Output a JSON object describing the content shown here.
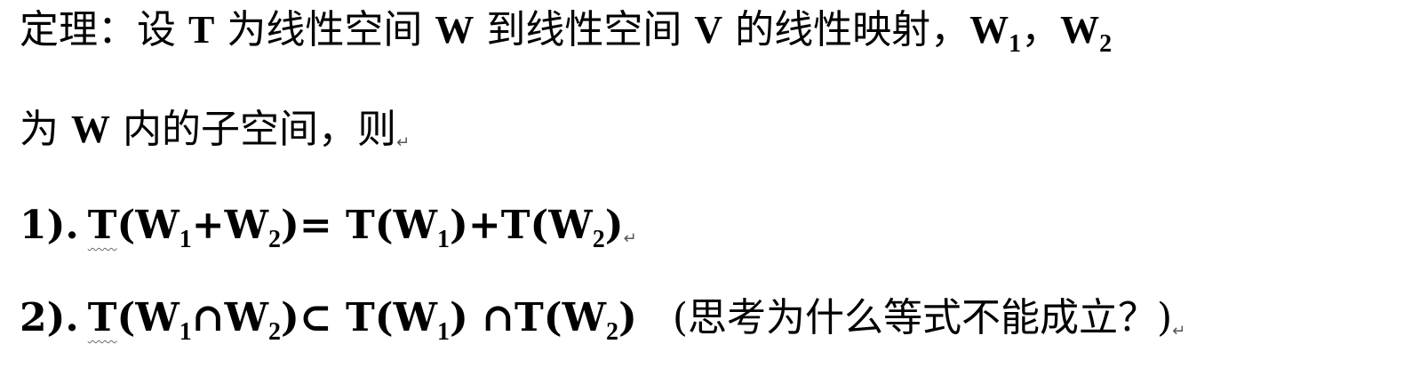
{
  "line1": {
    "label": "定理：设",
    "t": "T",
    "p1": "为线性空间",
    "w": "W",
    "p2": "到线性空间",
    "v": "V",
    "p3": "的线性映射，",
    "w1": "W",
    "sub1": "1",
    "comma": "，",
    "w2": "W",
    "sub2": "2"
  },
  "line2": {
    "p1": "为",
    "w": "W",
    "p2": "内的子空间，则"
  },
  "item1": {
    "num": "1).",
    "lhs_t": "T",
    "lhs_rest": "(W",
    "s1": "1",
    "mid": "+W",
    "s2": "2",
    "eq": ")= T(W",
    "s3": "1",
    "mid2": ")+T(W",
    "s4": "2",
    "end": ")"
  },
  "item2": {
    "num": "2).",
    "lhs_t": "T",
    "lhs_rest": "(W",
    "s1": "1",
    "cap": "∩W",
    "s2": "2",
    "subset": ")⊂ T(W",
    "s3": "1",
    "mid": ") ∩T(W",
    "s4": "2",
    "end": ")",
    "note": "(思考为什么等式不能成立？)"
  },
  "para_mark": "↵"
}
